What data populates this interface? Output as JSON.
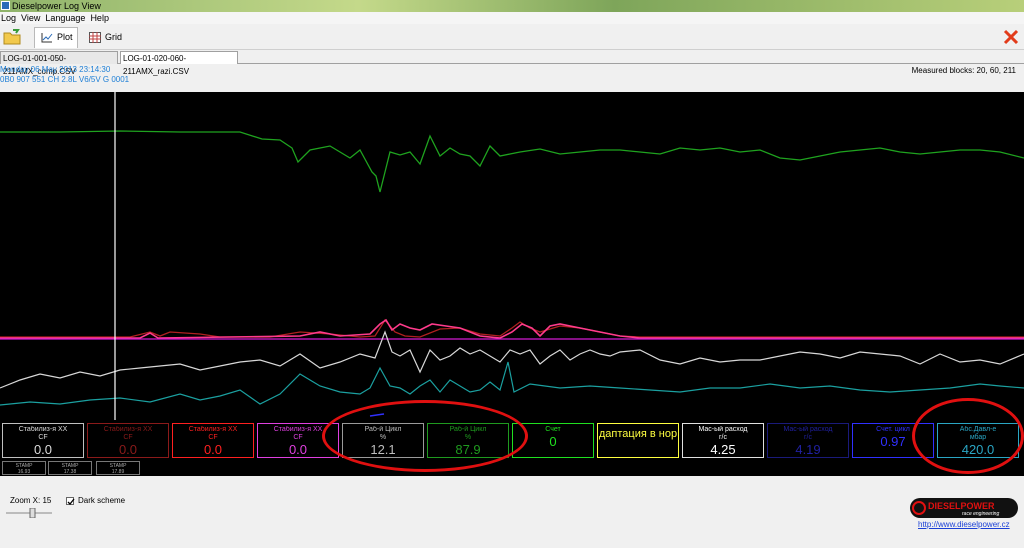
{
  "window": {
    "title": "Dieselpower Log View"
  },
  "menu": [
    "Log",
    "View",
    "Language",
    "Help"
  ],
  "toolbar": {
    "plot_label": "Plot",
    "grid_label": "Grid"
  },
  "file_tabs": [
    {
      "label": "LOG-01-001-050-211AMX_comp.CSV",
      "active": false
    },
    {
      "label": "LOG-01-020-060-211AMX_razi.CSV",
      "active": true
    }
  ],
  "info": {
    "date": "Monday 06 May 2013 23:14:30",
    "ecu": "0B0 907 551 CH  2.8L V6/5V     G   0001",
    "measured_blocks": "Measured blocks: 20, 60, 211"
  },
  "plot_series_colors": [
    "#1fa31f",
    "#ff3b8c",
    "#d41ad4",
    "#b02020",
    "#d8d8d8",
    "#1ba0a0"
  ],
  "gauges": [
    {
      "name": "Стабилиз-я XX",
      "unit": "CF",
      "value": "0.0",
      "color": "#dcdcdc",
      "border": "#c0c0c0"
    },
    {
      "name": "Стабилиз-я XX",
      "unit": "CF",
      "value": "0.0",
      "color": "#8b1a1a",
      "border": "#8b1a1a"
    },
    {
      "name": "Стабилиз-я XX",
      "unit": "CF",
      "value": "0.0",
      "color": "#ff2020",
      "border": "#ff2020"
    },
    {
      "name": "Стабилиз-я XX",
      "unit": "CF",
      "value": "0.0",
      "color": "#e040e0",
      "border": "#e040e0"
    },
    {
      "name": "Раб-й Цикл",
      "unit": "%",
      "value": "12.1",
      "color": "#bdbdbd",
      "border": "#9a9a9a"
    },
    {
      "name": "Раб-й Цикл",
      "unit": "%",
      "value": "87.9",
      "color": "#1f9a1f",
      "border": "#1f9a1f"
    },
    {
      "name": "Счет",
      "unit": "",
      "value": "0",
      "color": "#20e020",
      "border": "#20e020"
    },
    {
      "name": "",
      "unit": "",
      "value": "даптация в нор",
      "color": "#ffff40",
      "border": "#ffff40"
    },
    {
      "name": "Мас-ый расход",
      "unit": "г/с",
      "value": "4.25",
      "color": "#ffffff",
      "border": "#e0e0e0"
    },
    {
      "name": "Мас-ый расход",
      "unit": "г/с",
      "value": "4.19",
      "color": "#2020a0",
      "border": "#1a1a7a"
    },
    {
      "name": "Счет. цикл",
      "unit": "",
      "value": "0.97",
      "color": "#3030ff",
      "border": "#3030ff"
    },
    {
      "name": "Абс.Давл-е",
      "unit": "мбар",
      "value": "420.0",
      "color": "#2aa6c4",
      "border": "#2aa6c4"
    }
  ],
  "stamps": [
    {
      "label": "STAMP",
      "value": "16.93"
    },
    {
      "label": "STAMP",
      "value": "17.38"
    },
    {
      "label": "STAMP",
      "value": "17.89"
    }
  ],
  "bottom": {
    "zoom_label": "Zoom X: 15",
    "dark_scheme_label": "Dark scheme",
    "dark_scheme_checked": true
  },
  "branding": {
    "logo_text": "DIESELPOWER",
    "logo_sub": "race engineering",
    "site": "http://www.dieselpower.cz"
  }
}
